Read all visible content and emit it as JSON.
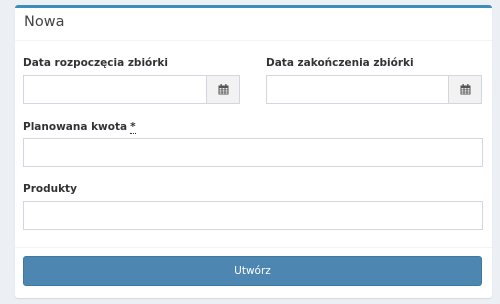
{
  "box": {
    "title": "Nowa"
  },
  "form": {
    "start_date": {
      "label": "Data rozpoczęcia zbiórki",
      "value": "",
      "icon": "calendar-icon"
    },
    "end_date": {
      "label": "Data zakończenia zbiórki",
      "value": "",
      "icon": "calendar-icon"
    },
    "amount": {
      "label": "Planowana kwota",
      "required_marker": "*",
      "value": ""
    },
    "products": {
      "label": "Produkty",
      "value": ""
    }
  },
  "actions": {
    "submit_label": "Utwórz"
  },
  "colors": {
    "accent": "#3c8dbc",
    "button": "#4d86b1",
    "background": "#ecf0f5"
  }
}
